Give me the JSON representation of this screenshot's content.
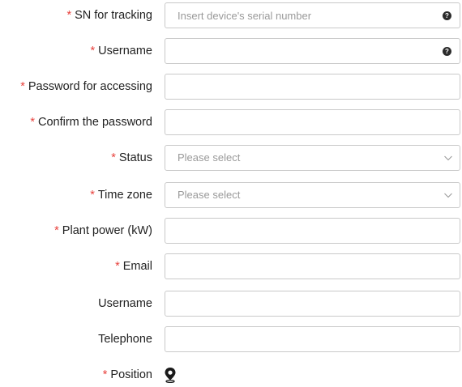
{
  "form": {
    "sn": {
      "required_mark": "*",
      "label": "SN for tracking",
      "placeholder": "Insert device's serial number",
      "help_icon": "question-icon",
      "help_glyph": "?"
    },
    "username": {
      "required_mark": "*",
      "label": "Username",
      "help_icon": "question-icon",
      "help_glyph": "?"
    },
    "password": {
      "required_mark": "*",
      "label": "Password for accessing"
    },
    "confirm_password": {
      "required_mark": "*",
      "label": "Confirm the password"
    },
    "status": {
      "required_mark": "*",
      "label": "Status",
      "selected_text": "Please select",
      "icon": "chevron-down-icon"
    },
    "time_zone": {
      "required_mark": "*",
      "label": "Time zone",
      "selected_text": "Please select",
      "icon": "chevron-down-icon"
    },
    "plant_power": {
      "required_mark": "*",
      "label": "Plant power (kW)"
    },
    "email": {
      "required_mark": "*",
      "label": "Email"
    },
    "contact_username": {
      "label": "Username"
    },
    "telephone": {
      "label": "Telephone"
    },
    "position": {
      "required_mark": "*",
      "label": "Position",
      "icon": "map-pin-icon"
    }
  },
  "colors": {
    "required": "#e8413c",
    "border": "#c9c9c9",
    "label_text": "#222222",
    "placeholder": "#9a9a9a"
  }
}
